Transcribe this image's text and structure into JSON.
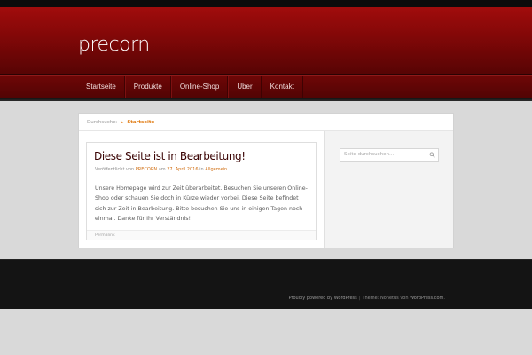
{
  "header": {
    "logo_text": "precorn",
    "nav": [
      "Startseite",
      "Produkte",
      "Online-Shop",
      "Über",
      "Kontakt"
    ]
  },
  "breadcrumb": {
    "label": "Durchsuche:",
    "current": "Startseite"
  },
  "post": {
    "title": "Diese Seite ist in Bearbeitung!",
    "meta_prefix": "Veröffentlicht von",
    "author": "PRECORN",
    "meta_on": "am",
    "date": "27. April 2016",
    "meta_in": "in",
    "category": "Allgemein",
    "body": "Unsere Homepage wird zur Zeit überarbeitet. Besuchen Sie unseren Online-Shop oder schauen Sie doch in Kürze wieder vorbei. Diese Seite befindet sich zur Zeit in Bearbeitung. Bitte besuchen Sie uns in einigen Tagen noch einmal. Danke für Ihr Verständnis!",
    "permalink": "Permalink"
  },
  "sidebar": {
    "search_placeholder": "Seite durchsuchen..."
  },
  "footer": {
    "powered": "Proudly powered by WordPress",
    "separator": "|",
    "theme_prefix": "Theme: Nonetus von",
    "theme_link": "WordPress.com",
    "period": "."
  },
  "colors": {
    "brand_red": "#8b0a0a",
    "accent_orange": "#e07a10"
  }
}
